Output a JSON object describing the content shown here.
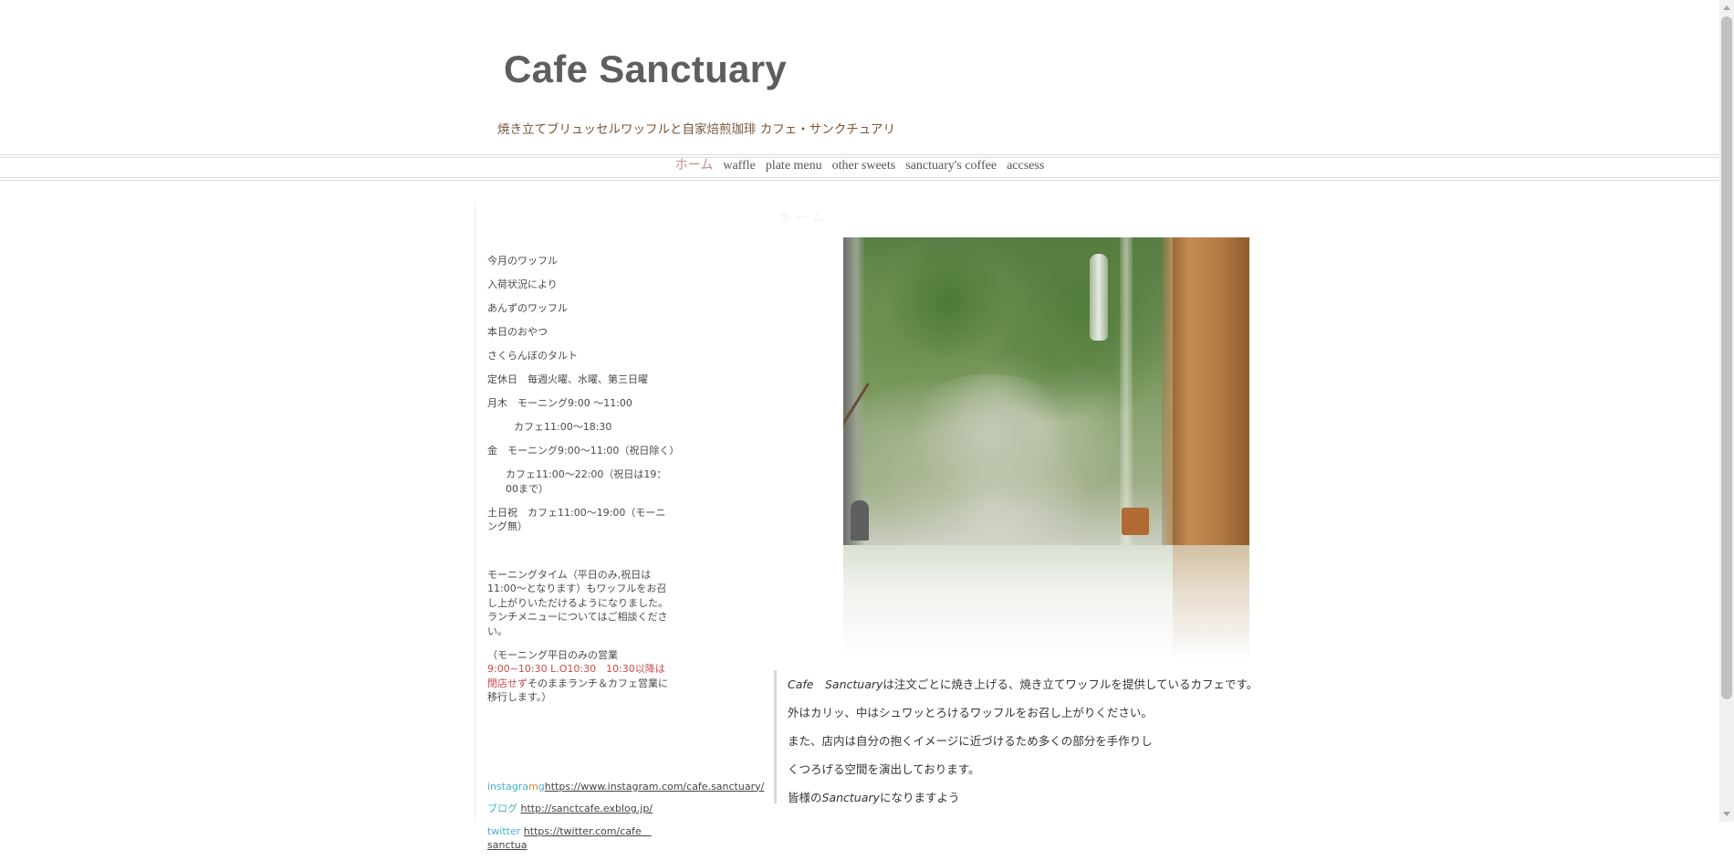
{
  "header": {
    "title": "Cafe Sanctuary",
    "tagline": "焼き立てブリュッセルワッフルと自家焙煎珈琲 カフェ・サンクチュアリ"
  },
  "nav": {
    "items": [
      "ホーム",
      "waffle",
      "plate menu",
      "other sweets",
      "sanctuary's coffee",
      "accsess"
    ],
    "active_index": 0
  },
  "faint_heading": "ホーム",
  "sidebar": {
    "lines": [
      "今月のワッフル",
      "入荷状況により",
      "あんずのワッフル",
      "本日のおやつ",
      "さくらんぼのタルト",
      "定休日　毎週火曜、水曜、第三日曜",
      "月木　モーニング9:00 ～11:00",
      "カフェ11:00～18:30",
      "金　モーニング9:00～11:00（祝日除く）",
      "カフェ11:00～22:00（祝日は19：00まで）",
      "土日祝　カフェ11:00～19:00（モーニング無）"
    ],
    "morning_note": "モーニングタイム（平日のみ,祝日は11:00～となります）もワッフルをお召し上がりいただけるようになりました。ランチメニューについてはご相談ください。",
    "morning_hours_prefix": "（モーニング平日のみの営業 ",
    "morning_hours_red": "9:00~10:30 L.O10:30　10:30以降は閉店せず",
    "morning_hours_suffix": "そのままランチ＆カフェ営業に移行します。）",
    "links": {
      "instagram_label_a": "instagra",
      "instagram_label_b": "m",
      "instagram_label_c": "g",
      "instagram_url": "https://www.instagram.com/cafe.sanctuary/",
      "blog_label": "ブログ",
      "blog_url": "http://sanctcafe.exblog.jp/",
      "twitter_label": "twitter",
      "twitter_url": "https://twitter.com/cafe＿sanctua"
    }
  },
  "content": {
    "line1_italic": "Cafe　Sanctuary",
    "line1_rest": "は注文ごとに焼き上げる、焼き立てワッフルを提供しているカフェです。",
    "line2": "外はカリッ、中はシュワッとろけるワッフルをお召し上がりください。",
    "line3": "また、店内は自分の抱くイメージに近づけるため多くの部分を手作りし",
    "line4": "くつろげる空間を演出しております。",
    "line5_prefix": "皆様の",
    "line5_italic": "Sanctuary",
    "line5_suffix": "になりますよう"
  },
  "colors": {
    "title": "#5e5e5e",
    "tagline": "#76563b",
    "nav_active": "#c88a8a",
    "red_text": "#cc4a4a",
    "instagram_cyan": "#48b3c8",
    "instagram_orange": "#d9832c"
  }
}
